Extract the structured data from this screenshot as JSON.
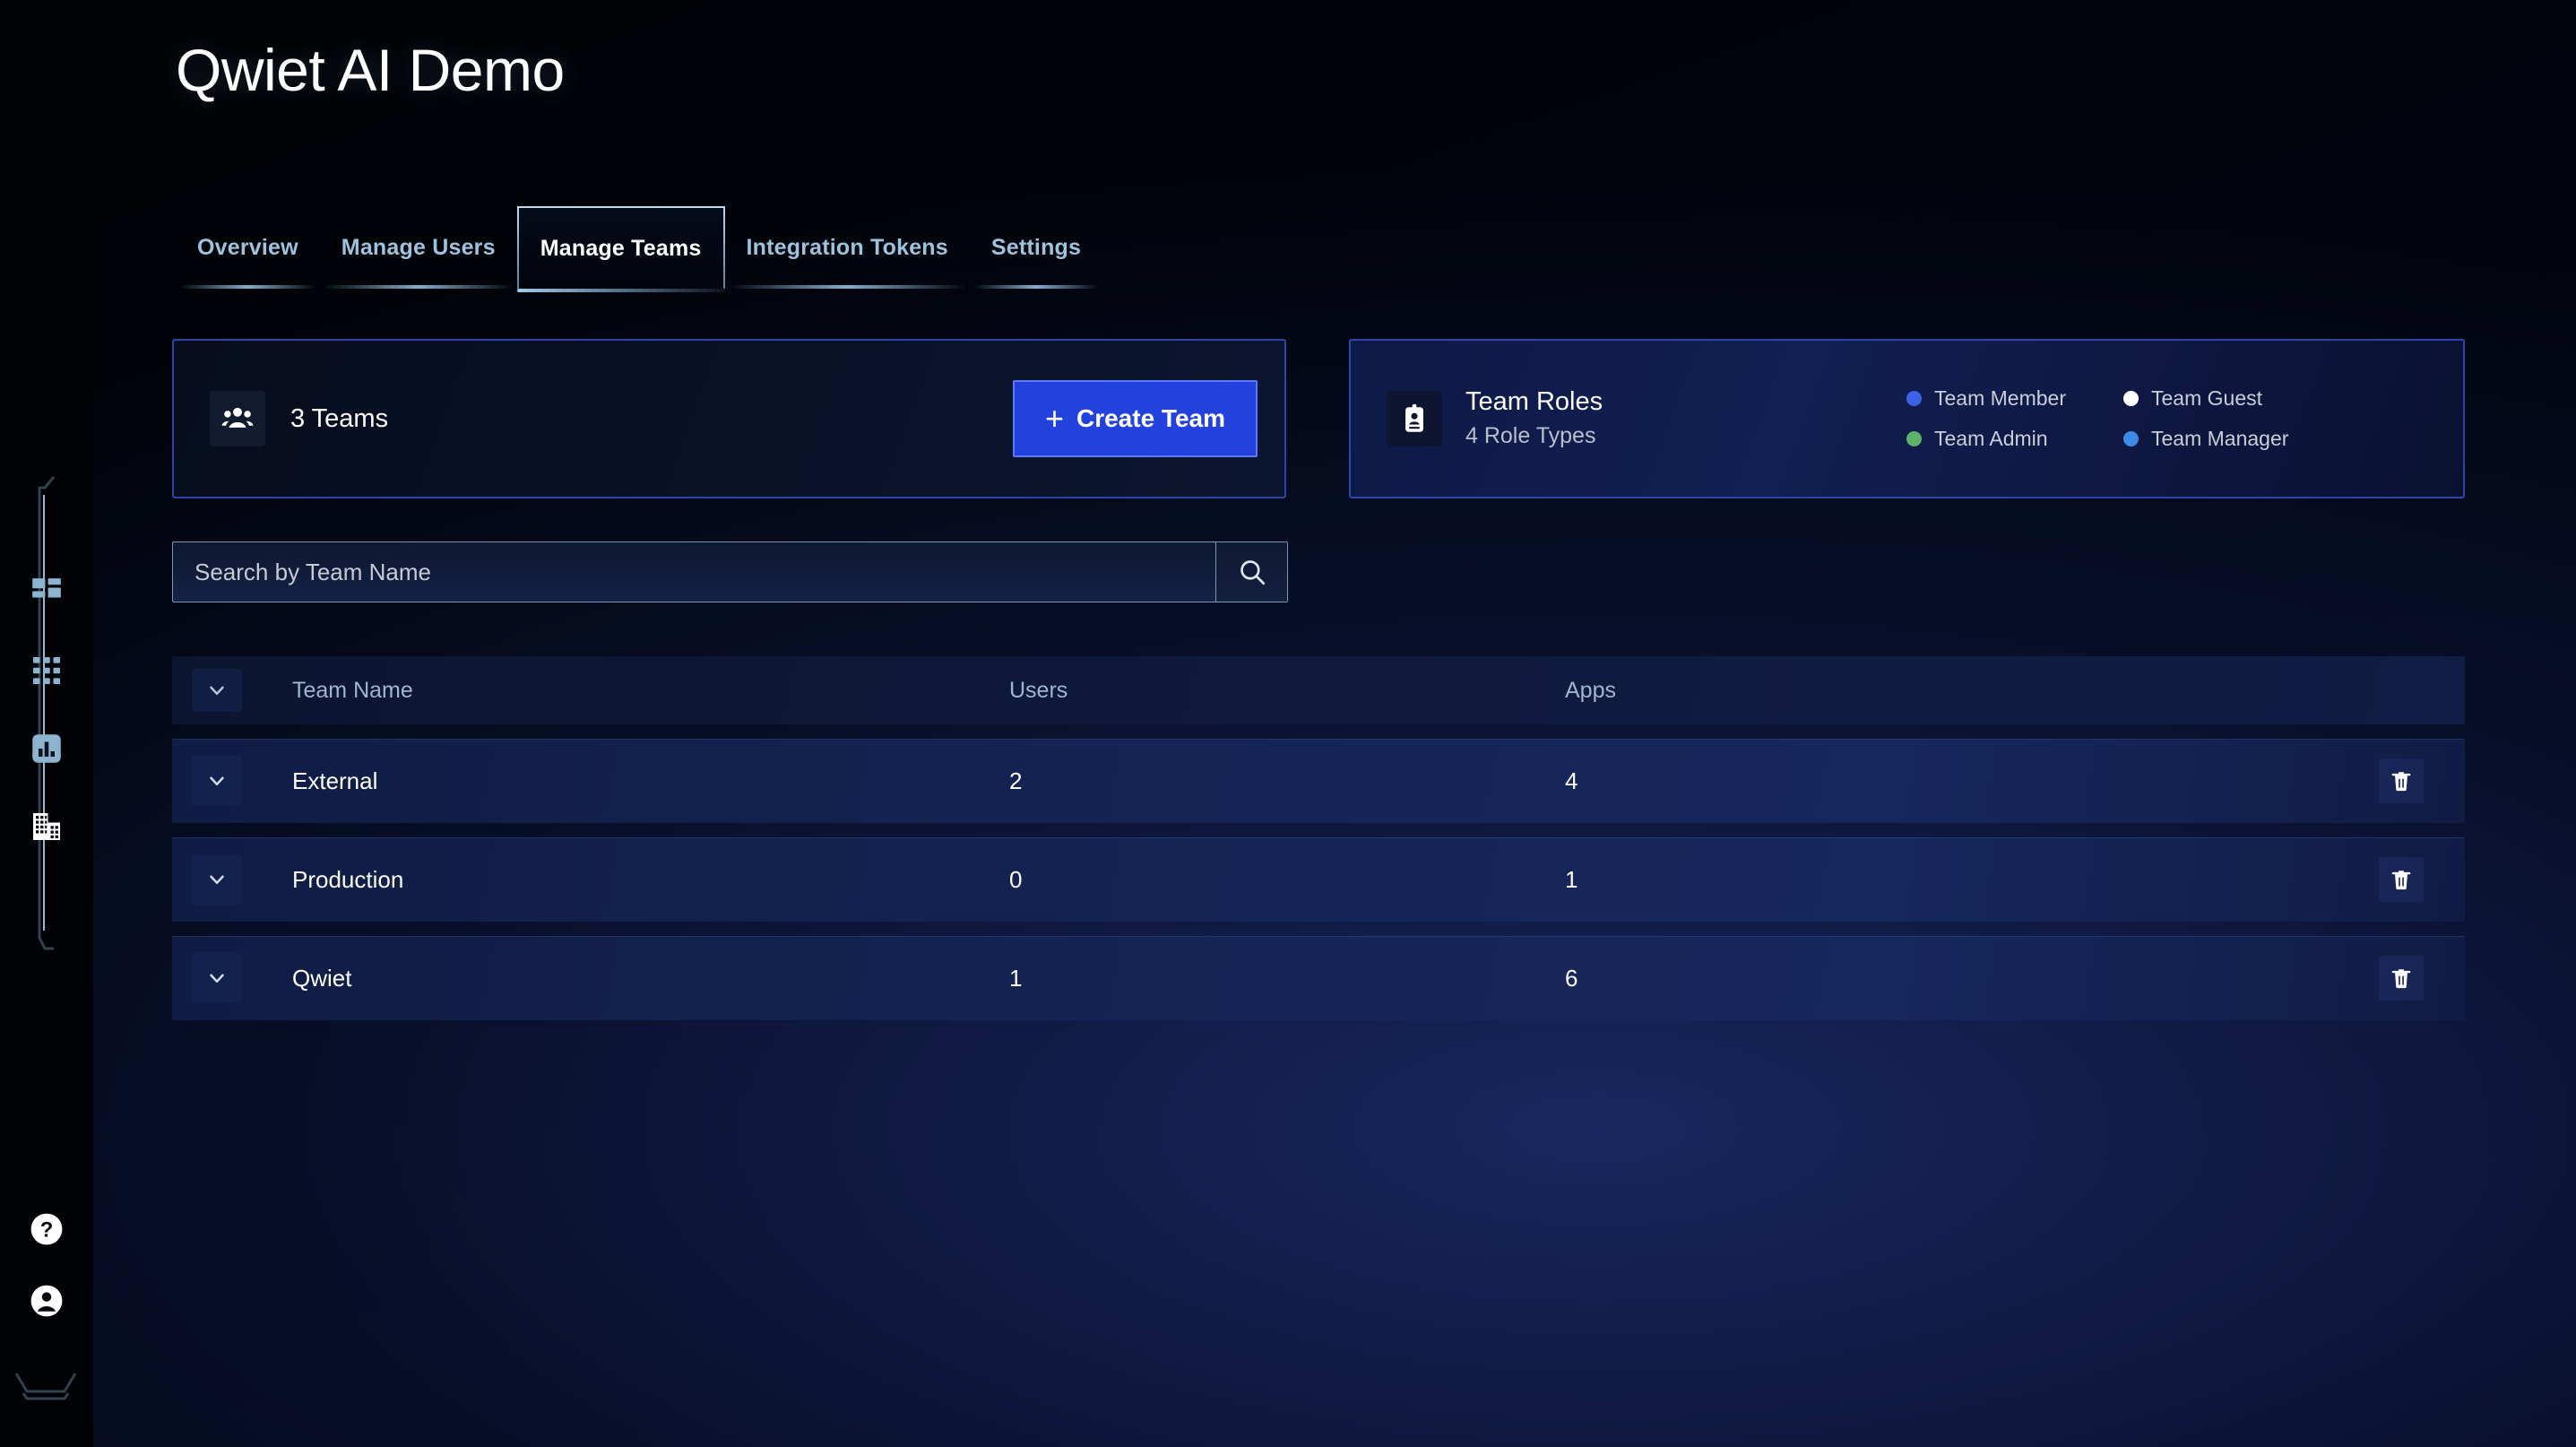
{
  "app": {
    "title": "Qwiet AI Demo",
    "logo_name": "qwiet-logo"
  },
  "tabs": [
    {
      "label": "Overview",
      "active": false
    },
    {
      "label": "Manage Users",
      "active": false
    },
    {
      "label": "Manage Teams",
      "active": true
    },
    {
      "label": "Integration Tokens",
      "active": false
    },
    {
      "label": "Settings",
      "active": false
    }
  ],
  "sidebar": {
    "items": [
      {
        "icon": "dashboard-icon",
        "name": "sidebar-item-dashboard"
      },
      {
        "icon": "grid-apps-icon",
        "name": "sidebar-item-applications"
      },
      {
        "icon": "bar-chart-icon",
        "name": "sidebar-item-reports"
      },
      {
        "icon": "organization-icon",
        "name": "sidebar-item-organization"
      }
    ],
    "bottom": [
      {
        "icon": "help-icon",
        "name": "sidebar-item-help"
      },
      {
        "icon": "account-icon",
        "name": "sidebar-item-account"
      }
    ]
  },
  "teams_card": {
    "icon": "people-group-icon",
    "count_label": "3 Teams",
    "create_button": "Create Team",
    "create_plus": "+"
  },
  "roles_card": {
    "icon": "id-badge-icon",
    "title": "Team Roles",
    "subtitle": "4 Role Types",
    "roles": [
      {
        "label": "Team Member",
        "color": "#3b63e8"
      },
      {
        "label": "Team Guest",
        "color": "#ffffff"
      },
      {
        "label": "Team Admin",
        "color": "#5cb368"
      },
      {
        "label": "Team Manager",
        "color": "#3b8ae8"
      }
    ]
  },
  "search": {
    "placeholder": "Search by Team Name",
    "value": "",
    "icon": "search-icon"
  },
  "table": {
    "columns": {
      "name": "Team Name",
      "users": "Users",
      "apps": "Apps"
    },
    "rows": [
      {
        "name": "External",
        "users": "2",
        "apps": "4"
      },
      {
        "name": "Production",
        "users": "0",
        "apps": "1"
      },
      {
        "name": "Qwiet",
        "users": "1",
        "apps": "6"
      }
    ]
  },
  "colors": {
    "accent_blue": "#2342dd",
    "card_border": "#2b45a8",
    "tab_inactive": "#9ec3dc",
    "tab_active": "#ffffff",
    "row_bg": "#152455"
  }
}
